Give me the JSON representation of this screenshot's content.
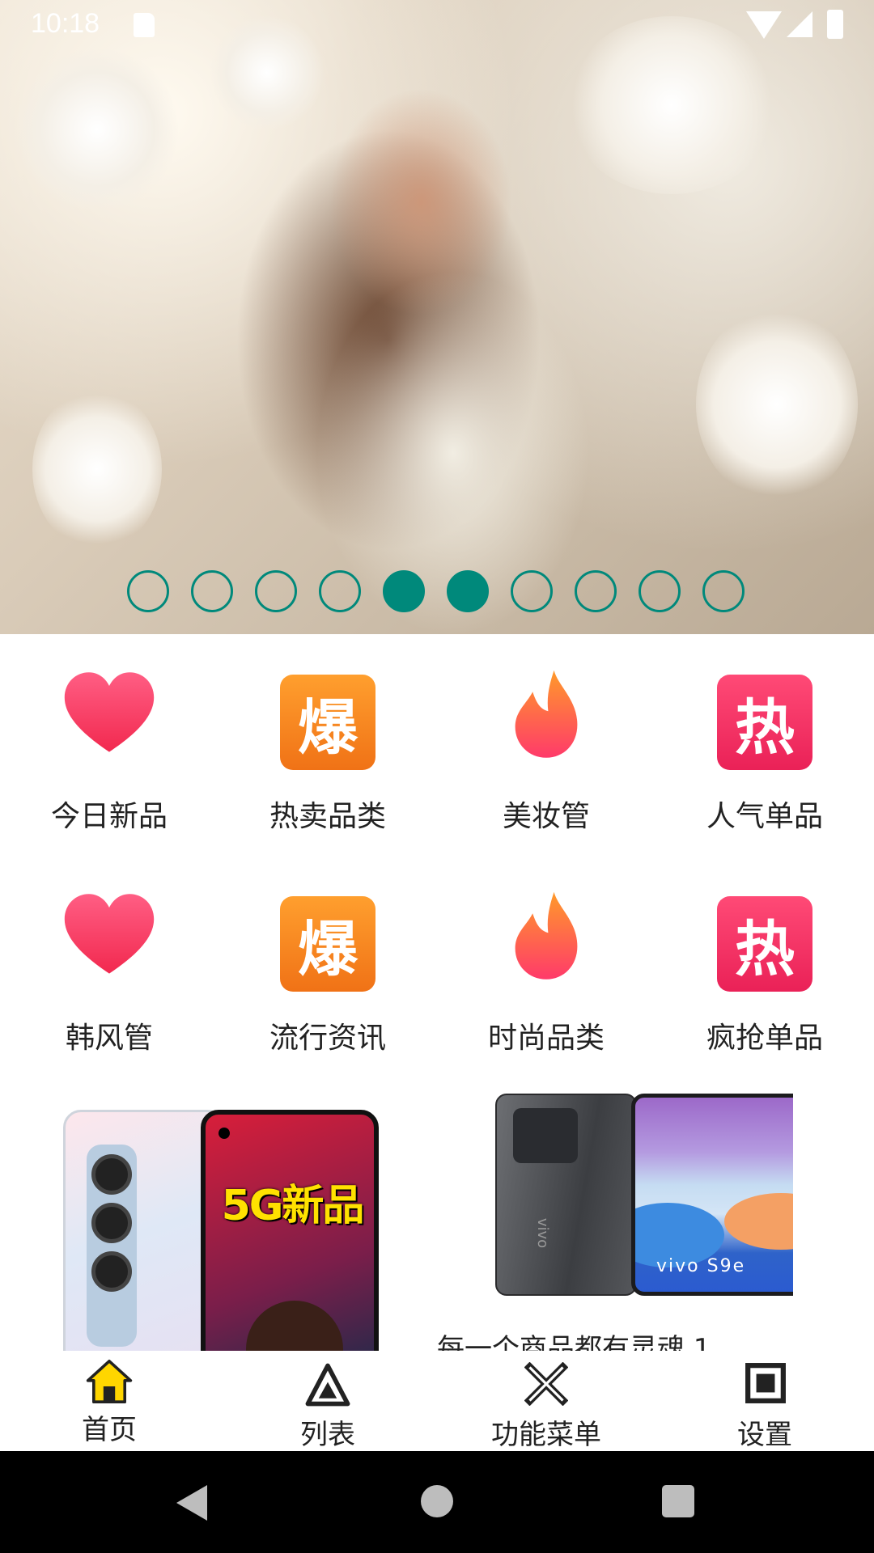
{
  "status_bar": {
    "time": "10:18"
  },
  "banner": {
    "dot_count": 10,
    "active_dots": [
      4,
      5
    ]
  },
  "categories": [
    {
      "label": "今日新品",
      "icon": "heart-icon"
    },
    {
      "label": "热卖品类",
      "icon": "bao-icon",
      "icon_text": "爆"
    },
    {
      "label": "美妆管",
      "icon": "flame-icon"
    },
    {
      "label": "人气单品",
      "icon": "re-icon",
      "icon_text": "热"
    },
    {
      "label": "韩风管",
      "icon": "heart-icon"
    },
    {
      "label": "流行资讯",
      "icon": "bao-icon",
      "icon_text": "爆"
    },
    {
      "label": "时尚品类",
      "icon": "flame-icon"
    },
    {
      "label": "疯抢单品",
      "icon": "re-icon",
      "icon_text": "热"
    }
  ],
  "products": [
    {
      "promo_text": "5G新品",
      "caption": ""
    },
    {
      "brand_text": "vivo S9e",
      "logo_text": "vivo",
      "caption": "每一个商品都有灵魂 1"
    }
  ],
  "bottom_nav": [
    {
      "label": "首页",
      "icon": "home-icon"
    },
    {
      "label": "列表",
      "icon": "triangle-icon"
    },
    {
      "label": "功能菜单",
      "icon": "x-box-icon"
    },
    {
      "label": "设置",
      "icon": "square-icon"
    }
  ],
  "colors": {
    "accent": "#00897b",
    "home_icon": "#ffd600"
  }
}
